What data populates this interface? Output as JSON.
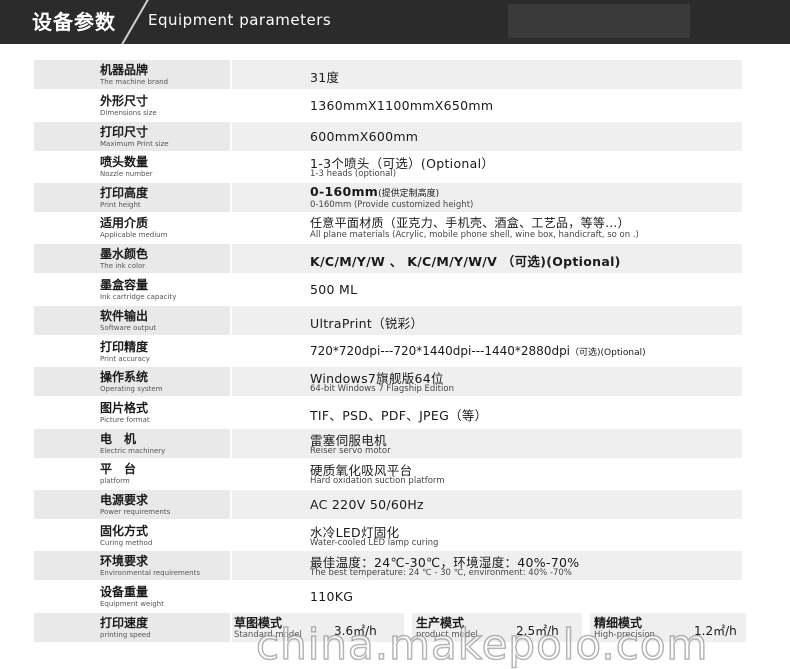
{
  "header": {
    "title_zh": "设备参数",
    "title_en": "Equipment parameters"
  },
  "rows": [
    {
      "label_zh": "机器品牌",
      "label_en": "The machine brand",
      "value": "31度",
      "value_en": ""
    },
    {
      "label_zh": "外形尺寸",
      "label_en": "Dimensions size",
      "value": "1360mmX1100mmX650mm",
      "value_en": ""
    },
    {
      "label_zh": "打印尺寸",
      "label_en": "Maximum Print size",
      "value": "600mmX600mm",
      "value_en": ""
    },
    {
      "label_zh": "喷头数量",
      "label_en": "Nozzle number",
      "value": "1-3个喷头（可选）(Optional）",
      "value_en": "1-3 heads (optional)"
    },
    {
      "label_zh": "打印高度",
      "label_en": "Print height",
      "value": "0-160mm",
      "value_note": "(提供定制高度)",
      "value_en": "0-160mm (Provide customized height)"
    },
    {
      "label_zh": "适用介质",
      "label_en": "Applicable medium",
      "value": "任意平面材质（亚克力、手机壳、酒盒、工艺品，等等...）",
      "value_en": "All plane materials (Acrylic, mobile phone shell, wine box, handicraft, so on .)"
    },
    {
      "label_zh": "墨水颜色",
      "label_en": "The ink color",
      "value": "K/C/M/Y/W 、 K/C/M/Y/W/V （可选)(Optional)",
      "value_en": ""
    },
    {
      "label_zh": "墨盒容量",
      "label_en": "Ink cartridge capacity",
      "value": "500 ML",
      "value_en": ""
    },
    {
      "label_zh": "软件输出",
      "label_en": "Software output",
      "value": "UltraPrint（锐彩）",
      "value_en": ""
    },
    {
      "label_zh": "打印精度",
      "label_en": "Print accuracy",
      "value": "720*720dpi---720*1440dpi---1440*2880dpi",
      "value_note": "（可选)(Optional)",
      "value_en": ""
    },
    {
      "label_zh": "操作系统",
      "label_en": "Operating system",
      "value": "Windows7旗舰版64位",
      "value_en": "64-bit Windows 7 Flagship Edition"
    },
    {
      "label_zh": "图片格式",
      "label_en": "Picture format",
      "value": "TIF、PSD、PDF、JPEG（等）",
      "value_en": ""
    },
    {
      "label_zh": "电　机",
      "label_en": "Electric machinery",
      "value": "雷塞伺服电机",
      "value_en": "Reiser servo motor"
    },
    {
      "label_zh": "平　台",
      "label_en": "platform",
      "value": "硬质氧化吸风平台",
      "value_en": "Hard oxidation suction platform"
    },
    {
      "label_zh": "电源要求",
      "label_en": "Power requirements",
      "value": "AC 220V 50/60Hz",
      "value_en": ""
    },
    {
      "label_zh": "固化方式",
      "label_en": "Curing method",
      "value": "水冷LED灯固化",
      "value_en": "Water-cooled LED lamp curing"
    },
    {
      "label_zh": "环境要求",
      "label_en": "Environmental requirements",
      "value": "最佳温度：24℃-30℃，环境湿度：40%-70%",
      "value_en": "The best temperature: 24 ℃ - 30 ℃, environment: 40% -70%"
    },
    {
      "label_zh": "设备重量",
      "label_en": "Equipment weight",
      "value": "110KG",
      "value_en": ""
    }
  ],
  "speed": {
    "label_zh": "打印速度",
    "label_en": "printing speed",
    "modes": [
      {
        "name_zh": "草图模式",
        "name_en": "Standard model",
        "rate": "3.6㎡/h"
      },
      {
        "name_zh": "生产模式",
        "name_en": "product model",
        "rate": "2.5㎡/h"
      },
      {
        "name_zh": "精细模式",
        "name_en": "High-precision",
        "rate": "1.2㎡/h"
      }
    ]
  },
  "watermark": "china.makepolo.com"
}
